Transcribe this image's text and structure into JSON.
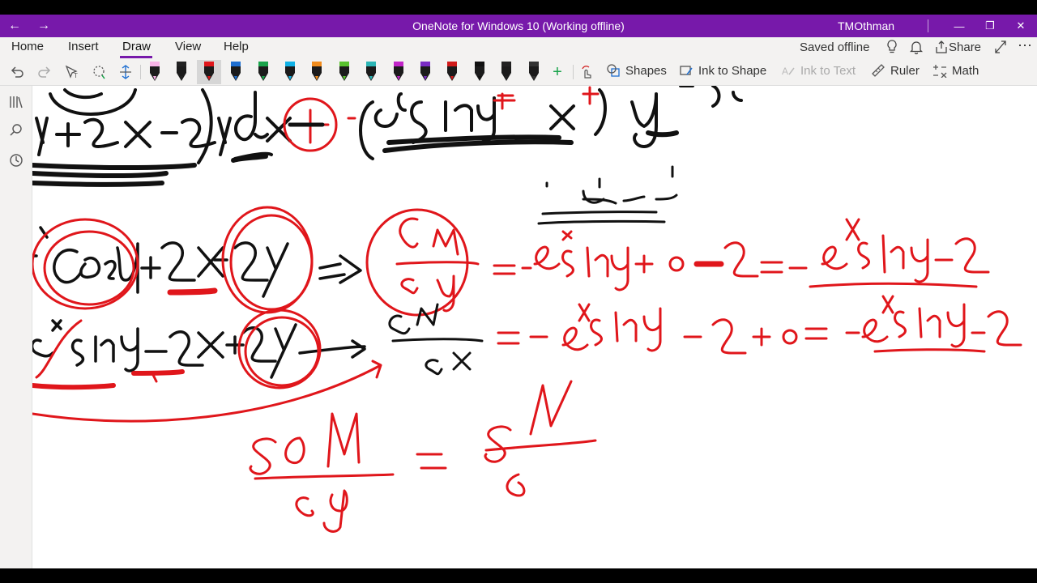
{
  "window": {
    "title": "OneNote for Windows 10 (Working offline)",
    "user": "TMOthman"
  },
  "ribbon": {
    "tabs": [
      {
        "label": "Home"
      },
      {
        "label": "Insert"
      },
      {
        "label": "Draw"
      },
      {
        "label": "View"
      },
      {
        "label": "Help"
      }
    ],
    "active_tab": "Draw",
    "status": "Saved offline",
    "share_label": "Share"
  },
  "toolbar": {
    "shapes_label": "Shapes",
    "ink_to_shape_label": "Ink to Shape",
    "ink_to_text_label": "Ink to Text",
    "ruler_label": "Ruler",
    "math_label": "Math",
    "pens": [
      {
        "color": "#f7b2e6"
      },
      {
        "color": "#222222"
      },
      {
        "color": "#e0161b"
      },
      {
        "color": "#1f6fd1"
      },
      {
        "color": "#19a34a"
      },
      {
        "color": "#10b1e6"
      },
      {
        "color": "#f28c1c"
      },
      {
        "color": "#59c22e"
      },
      {
        "color": "#2bb5b5"
      },
      {
        "color": "#c225c9"
      },
      {
        "color": "#7a2cc4"
      },
      {
        "color": "#d11a1a"
      },
      {
        "color": "#111111"
      },
      {
        "color": "#222222"
      },
      {
        "color": "#333333"
      }
    ]
  },
  "colors": {
    "accent": "#7719aa",
    "ink_black": "#111111",
    "ink_red": "#e0161b"
  }
}
